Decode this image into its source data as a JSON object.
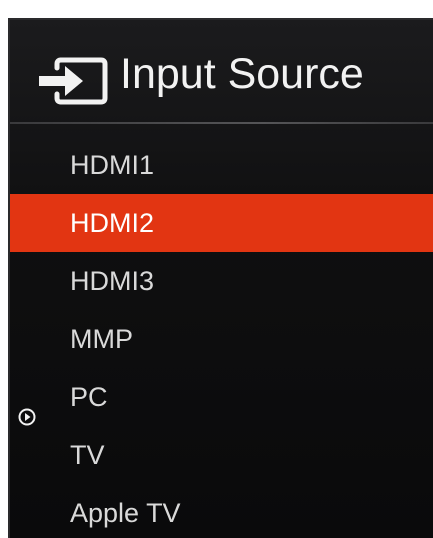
{
  "menu": {
    "title": "Input Source",
    "title_icon": "input-source-icon",
    "accent_color": "#e23512",
    "items": [
      {
        "label": "HDMI1",
        "selected": false,
        "active": false
      },
      {
        "label": "HDMI2",
        "selected": true,
        "active": false
      },
      {
        "label": "HDMI3",
        "selected": false,
        "active": false
      },
      {
        "label": "MMP",
        "selected": false,
        "active": false
      },
      {
        "label": "PC",
        "selected": false,
        "active": true,
        "indicator_icon": "current-source-icon"
      },
      {
        "label": "TV",
        "selected": false,
        "active": false
      },
      {
        "label": "Apple TV",
        "selected": false,
        "active": false
      }
    ]
  }
}
